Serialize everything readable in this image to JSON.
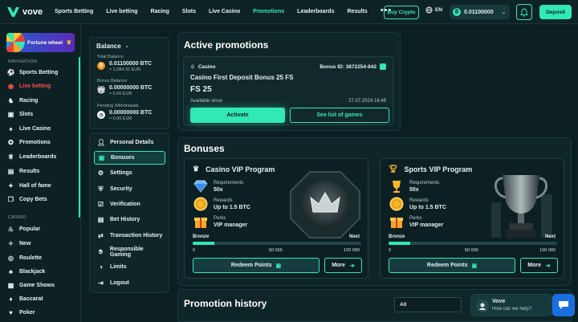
{
  "header": {
    "logo_text": "vove",
    "nav": [
      "Sports Betting",
      "Live betting",
      "Racing",
      "Slots",
      "Live Casino",
      "Promotions",
      "Leaderboards",
      "Results"
    ],
    "nav_active": "Promotions",
    "more_dots": "•••",
    "buy_crypto": "Buy Crypto",
    "language": "EN",
    "wallet_amount": "0.01100000",
    "deposit": "Deposit",
    "accent": "#32e8b4"
  },
  "sidebar": {
    "fortune_wheel": "Fortune wheel",
    "navigation_title": "NAVIGATION",
    "nav_items": [
      "Sports Betting",
      "Live betting",
      "Racing",
      "Slots",
      "Live Casino",
      "Promotions",
      "Leaderboards",
      "Results",
      "Hall of fame",
      "Copy Bets"
    ],
    "casino_title": "CASINO",
    "casino_items": [
      "Popular",
      "New",
      "Roulette",
      "Blackjack",
      "Game Shows",
      "Baccarat",
      "Poker"
    ]
  },
  "account": {
    "balance_title": "Balance",
    "total_balance_label": "Total Balance",
    "total_balance": "0.01100000 BTC",
    "total_balance_eur": "≈ 1,084.32 EUR",
    "bonus_balance_label": "Bonus Balance",
    "bonus_balance": "0.00000000 BTC",
    "bonus_balance_eur": "≈ 0.00 EUR",
    "pending_label": "Pending Withdrawals",
    "pending": "0.00000000 BTC",
    "pending_eur": "≈ 0.00 EUR",
    "menu": [
      "Personal Details",
      "Bonuses",
      "Settings",
      "Security",
      "Verification",
      "Bet History",
      "Transaction History",
      "Responsible Gaming",
      "Limits",
      "Logout"
    ],
    "menu_active": "Bonuses"
  },
  "active_promotions": {
    "title": "Active promotions",
    "category": "Casino",
    "bonus_id": "Bonus ID: 3872254-842",
    "promo_title": "Casino First Deposit Bonus 25 FS",
    "fs": "FS 25",
    "available_since": "Available since",
    "date": "27.07.2024 16:48",
    "activate": "Activate",
    "see_games": "See list of games"
  },
  "bonuses": {
    "title": "Bonuses",
    "programs": [
      {
        "name": "Casino VIP Program",
        "requirements_label": "Requirements",
        "requirements": "50x",
        "rewards_label": "Rewards",
        "rewards": "Up to 1.5 BTC",
        "perks_label": "Perks",
        "perks": "VIP manager",
        "level_from": "Bronze",
        "level_to": "Next",
        "progress": 0.13,
        "tick_min": "0",
        "tick_mid": "50 000",
        "tick_max": "100 000",
        "redeem": "Redeem Points",
        "more": "More"
      },
      {
        "name": "Sports VIP Program",
        "requirements_label": "Requirements",
        "requirements": "50x",
        "rewards_label": "Rewards",
        "rewards": "Up to 1.5 BTC",
        "perks_label": "Perks",
        "perks": "VIP manager",
        "level_from": "Bronze",
        "level_to": "Next",
        "progress": 0.13,
        "tick_min": "0",
        "tick_mid": "50 000",
        "tick_max": "100 000",
        "redeem": "Redeem Points",
        "more": "More"
      }
    ]
  },
  "promotion_history": {
    "title": "Promotion history",
    "filter": "All"
  },
  "chat": {
    "name": "Vove",
    "message": "How can we help?"
  }
}
